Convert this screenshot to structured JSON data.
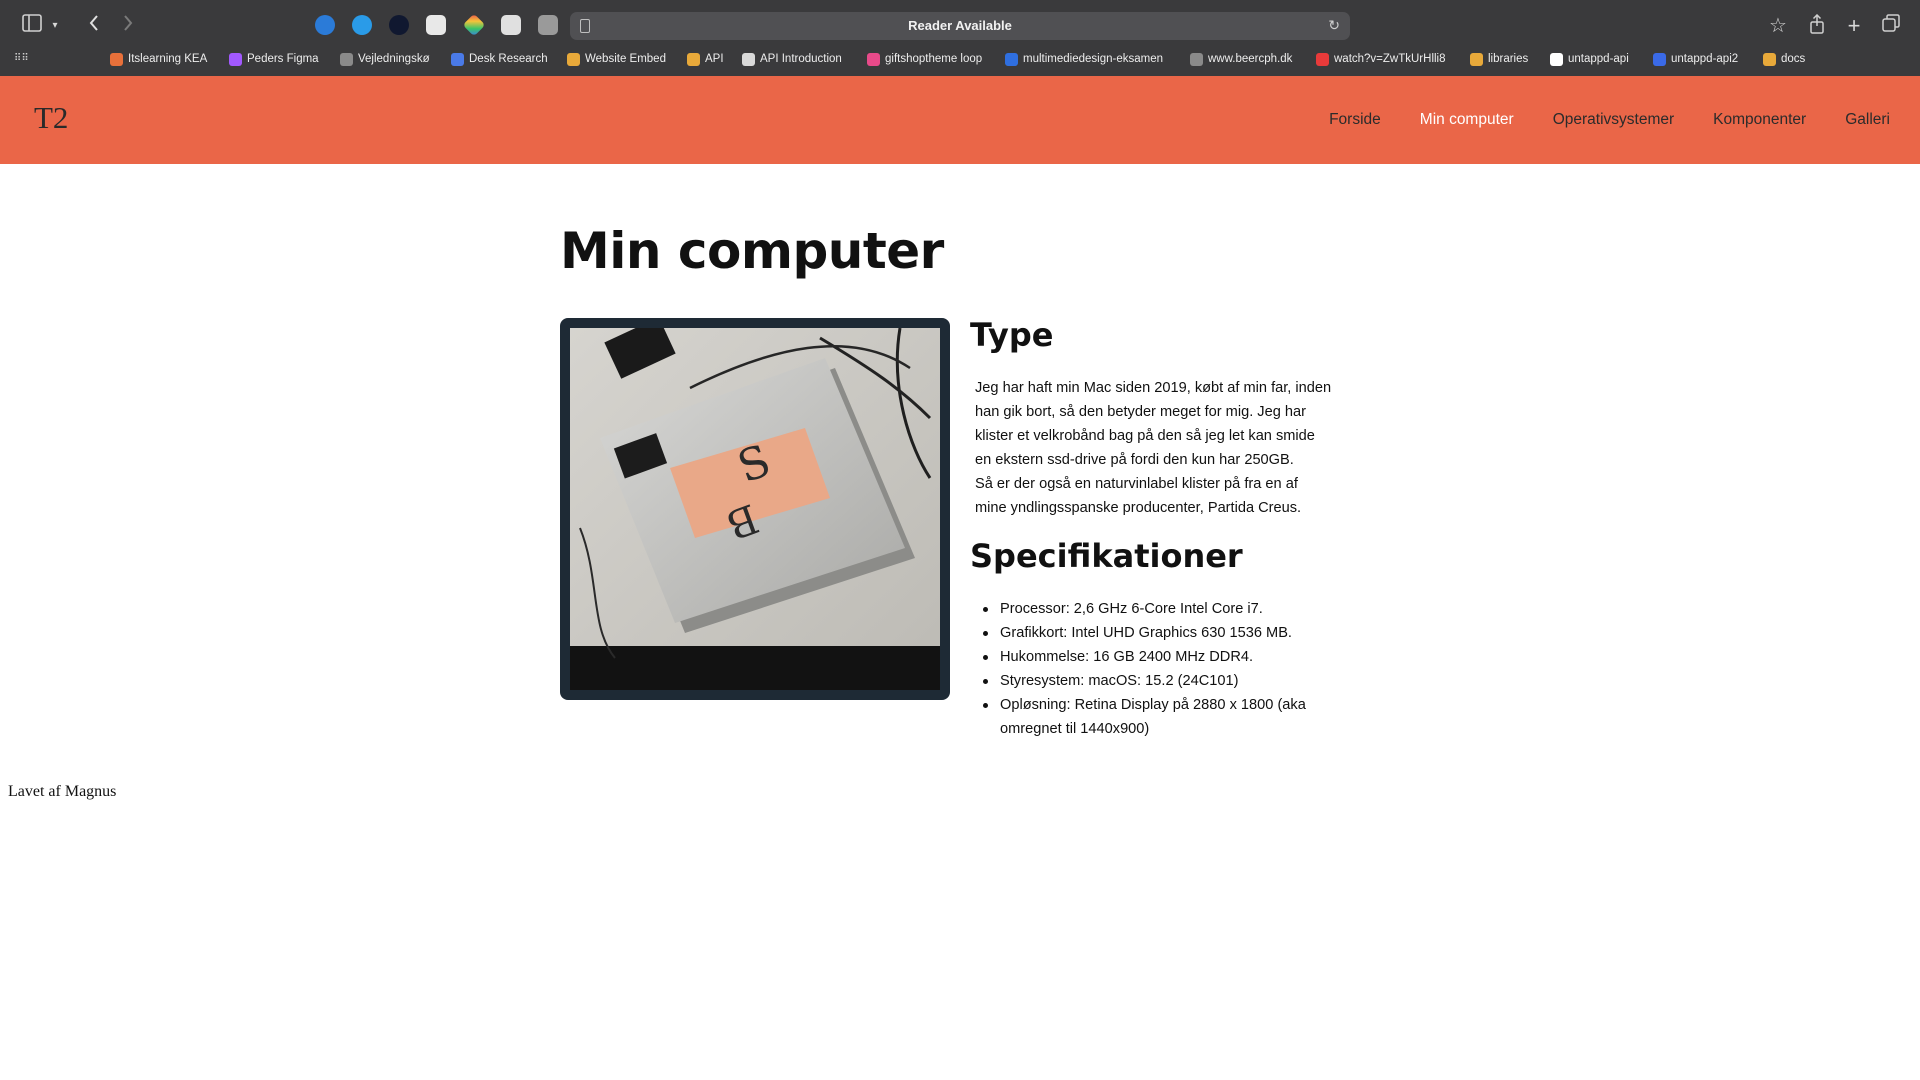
{
  "browser": {
    "url_text": "Reader Available",
    "bookmarks": [
      {
        "label": "Itslearning KEA",
        "color": "#e8703a"
      },
      {
        "label": "Peders Figma",
        "color": "#a259ff"
      },
      {
        "label": "Vejledningskø",
        "color": "#8a8a8a"
      },
      {
        "label": "Desk Research",
        "color": "#4a7ae8"
      },
      {
        "label": "Website Embed",
        "color": "#e8a93a"
      },
      {
        "label": "API",
        "color": "#e8a93a"
      },
      {
        "label": "API Introduction",
        "color": "#d9d9d9"
      },
      {
        "label": "giftshoptheme loop",
        "color": "#e84a8a"
      },
      {
        "label": "multimediedesign-eksamen",
        "color": "#2f6fe0"
      },
      {
        "label": "www.beercph.dk",
        "color": "#8a8a8a"
      },
      {
        "label": "watch?v=ZwTkUrHlli8",
        "color": "#e83a3a"
      },
      {
        "label": "libraries",
        "color": "#e8a93a"
      },
      {
        "label": "untappd-api",
        "color": "#ffffff"
      },
      {
        "label": "untappd-api2",
        "color": "#3a6ae8"
      },
      {
        "label": "docs",
        "color": "#e8a93a"
      }
    ]
  },
  "site": {
    "logo": "T2",
    "nav": [
      {
        "label": "Forside",
        "active": false
      },
      {
        "label": "Min computer",
        "active": true
      },
      {
        "label": "Operativsystemer",
        "active": false
      },
      {
        "label": "Komponenter",
        "active": false
      },
      {
        "label": "Galleri",
        "active": false
      }
    ],
    "header_color": "#ea6648"
  },
  "main": {
    "title": "Min computer",
    "type_heading": "Type",
    "type_lines": [
      "Jeg har haft min Mac siden 2019, købt af min far, inden",
      "han gik bort, så den betyder meget for mig. Jeg har",
      "klister et velkrobånd bag på den så jeg let kan smide",
      "en ekstern ssd-drive på fordi den kun har 250GB.",
      "Så er der også en naturvinlabel klister på fra en af",
      "mine yndlingsspanske producenter, Partida Creus."
    ],
    "spec_heading": "Specifikationer",
    "specs": [
      "Processor: 2,6 GHz 6-Core Intel Core i7.",
      "Grafikkort: Intel UHD Graphics 630 1536 MB.",
      "Hukommelse: 16 GB 2400 MHz DDR4.",
      "Styresystem: macOS: 15.2 (24C101)",
      "Opløsning: Retina Display på 2880 x 1800 (aka omregnet til 1440x900)"
    ]
  },
  "footer": {
    "text": "Lavet af Magnus"
  }
}
